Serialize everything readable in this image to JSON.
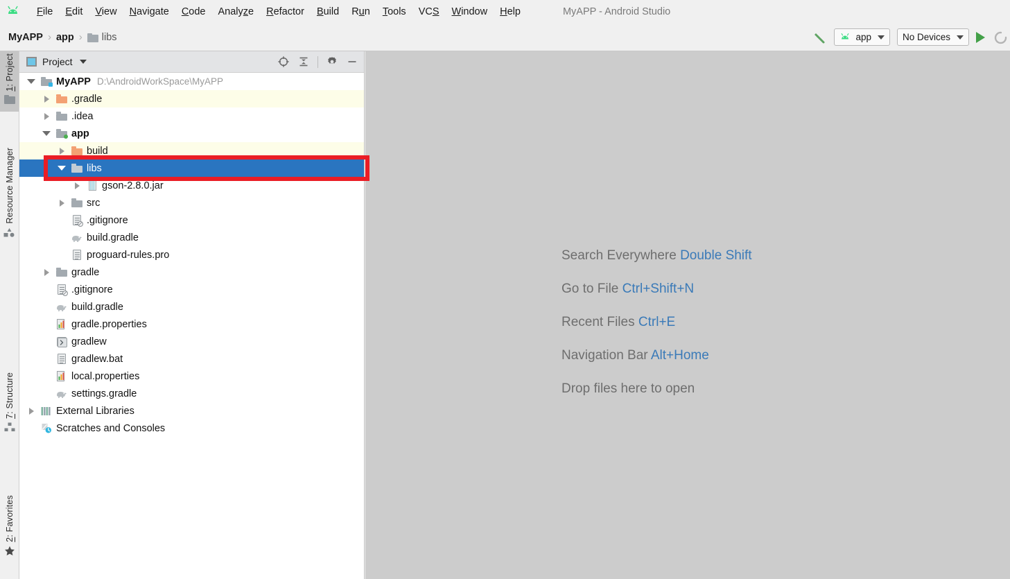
{
  "window": {
    "title": "MyAPP - Android Studio",
    "logo_icon": "android-robot-icon"
  },
  "menubar": {
    "items": [
      {
        "label": "File",
        "mnemonic": "F"
      },
      {
        "label": "Edit",
        "mnemonic": "E"
      },
      {
        "label": "View",
        "mnemonic": "V"
      },
      {
        "label": "Navigate",
        "mnemonic": "N"
      },
      {
        "label": "Code",
        "mnemonic": "C"
      },
      {
        "label": "Analyze",
        "mnemonic": "z"
      },
      {
        "label": "Refactor",
        "mnemonic": "R"
      },
      {
        "label": "Build",
        "mnemonic": "B"
      },
      {
        "label": "Run",
        "mnemonic": "u"
      },
      {
        "label": "Tools",
        "mnemonic": "T"
      },
      {
        "label": "VCS",
        "mnemonic": "S"
      },
      {
        "label": "Window",
        "mnemonic": "W"
      },
      {
        "label": "Help",
        "mnemonic": "H"
      }
    ]
  },
  "toolbar": {
    "breadcrumb": [
      {
        "label": "MyAPP",
        "style": "strong"
      },
      {
        "label": "app",
        "style": "strong"
      },
      {
        "label": "libs",
        "style": "plain",
        "icon": "folder-icon"
      }
    ],
    "separator": "›",
    "build_icon": "hammer-icon",
    "run_config": "app",
    "run_config_icon": "android-robot-icon",
    "device_selector": "No Devices",
    "run_icon": "run-triangle-icon",
    "debug_icon": "debug-icon"
  },
  "stripe": {
    "left_top": [
      {
        "label": "1: Project",
        "mnemonic": "1",
        "icon": "project-folder-icon",
        "active": true
      },
      {
        "label": "Resource Manager",
        "icon": "shapes-icon",
        "active": false
      }
    ],
    "left_bottom": [
      {
        "label": "7: Structure",
        "mnemonic": "7",
        "icon": "structure-icon",
        "active": false
      },
      {
        "label": "2: Favorites",
        "mnemonic": "2",
        "icon": "star-icon",
        "active": false
      }
    ]
  },
  "project_panel": {
    "header": {
      "title": "Project",
      "view_icon": "project-view-icon",
      "caret_icon": "chevron-down-icon",
      "locate_icon": "locate-target-icon",
      "collapse_icon": "collapse-all-icon",
      "settings_icon": "gear-icon",
      "minimize_icon": "minimize-icon"
    },
    "tree": [
      {
        "id": "root-myapp",
        "label": "MyAPP",
        "path": "D:\\AndroidWorkSpace\\MyAPP",
        "indent": 0,
        "twisty": "down",
        "icon": "folder-module-icon",
        "icon_kind": "folder-gray-blue",
        "bold": true
      },
      {
        "id": "node-gradle-dir",
        "label": ".gradle",
        "indent": 1,
        "twisty": "right",
        "icon": "folder-excluded-icon",
        "icon_kind": "folder-orange",
        "excluded": true
      },
      {
        "id": "node-idea",
        "label": ".idea",
        "indent": 1,
        "twisty": "right",
        "icon": "folder-icon",
        "icon_kind": "folder-gray"
      },
      {
        "id": "node-app",
        "label": "app",
        "indent": 1,
        "twisty": "down",
        "icon": "folder-module-icon",
        "icon_kind": "folder-gray-green",
        "bold": true
      },
      {
        "id": "node-app-build",
        "label": "build",
        "indent": 2,
        "twisty": "right",
        "icon": "folder-excluded-icon",
        "icon_kind": "folder-orange",
        "excluded": true
      },
      {
        "id": "node-app-libs",
        "label": "libs",
        "indent": 2,
        "twisty": "down",
        "icon": "folder-icon",
        "icon_kind": "folder-gray",
        "selected": true
      },
      {
        "id": "node-gson-jar",
        "label": "gson-2.8.0.jar",
        "indent": 3,
        "twisty": "right",
        "icon": "jar-icon",
        "icon_kind": "jar"
      },
      {
        "id": "node-app-src",
        "label": "src",
        "indent": 2,
        "twisty": "right",
        "icon": "folder-icon",
        "icon_kind": "folder-gray"
      },
      {
        "id": "node-app-gitignore",
        "label": ".gitignore",
        "indent": 2,
        "twisty": "none",
        "icon": "gitignore-file-icon",
        "icon_kind": "doc-ignored"
      },
      {
        "id": "node-app-build-gradle",
        "label": "build.gradle",
        "indent": 2,
        "twisty": "none",
        "icon": "gradle-elephant-icon",
        "icon_kind": "gradle"
      },
      {
        "id": "node-proguard",
        "label": "proguard-rules.pro",
        "indent": 2,
        "twisty": "none",
        "icon": "text-file-icon",
        "icon_kind": "doc"
      },
      {
        "id": "node-gradle-wrapper",
        "label": "gradle",
        "indent": 1,
        "twisty": "right",
        "icon": "folder-icon",
        "icon_kind": "folder-gray"
      },
      {
        "id": "node-root-gitignore",
        "label": ".gitignore",
        "indent": 1,
        "twisty": "none",
        "icon": "gitignore-file-icon",
        "icon_kind": "doc-ignored"
      },
      {
        "id": "node-root-build-gradle",
        "label": "build.gradle",
        "indent": 1,
        "twisty": "none",
        "icon": "gradle-elephant-icon",
        "icon_kind": "gradle"
      },
      {
        "id": "node-gradle-properties",
        "label": "gradle.properties",
        "indent": 1,
        "twisty": "none",
        "icon": "properties-file-icon",
        "icon_kind": "props"
      },
      {
        "id": "node-gradlew",
        "label": "gradlew",
        "indent": 1,
        "twisty": "none",
        "icon": "shell-script-icon",
        "icon_kind": "script"
      },
      {
        "id": "node-gradlew-bat",
        "label": "gradlew.bat",
        "indent": 1,
        "twisty": "none",
        "icon": "text-file-icon",
        "icon_kind": "doc"
      },
      {
        "id": "node-local-properties",
        "label": "local.properties",
        "indent": 1,
        "twisty": "none",
        "icon": "properties-file-icon",
        "icon_kind": "props"
      },
      {
        "id": "node-settings-gradle",
        "label": "settings.gradle",
        "indent": 1,
        "twisty": "none",
        "icon": "gradle-elephant-icon",
        "icon_kind": "gradle"
      },
      {
        "id": "node-external-libraries",
        "label": "External Libraries",
        "indent": 0,
        "twisty": "right",
        "icon": "libraries-icon",
        "icon_kind": "extlib"
      },
      {
        "id": "node-scratches",
        "label": "Scratches and Consoles",
        "indent": 0,
        "twisty": "none",
        "icon": "scratches-icon",
        "icon_kind": "scratch"
      }
    ]
  },
  "annotation": {
    "shape": "rectangle",
    "color": "#ea1d25",
    "targets": "node-app-libs"
  },
  "editor": {
    "hints": [
      {
        "action": "Search Everywhere",
        "shortcut": "Double Shift"
      },
      {
        "action": "Go to File",
        "shortcut": "Ctrl+Shift+N"
      },
      {
        "action": "Recent Files",
        "shortcut": "Ctrl+E"
      },
      {
        "action": "Navigation Bar",
        "shortcut": "Alt+Home"
      },
      {
        "action": "Drop files here to open",
        "shortcut": ""
      }
    ]
  },
  "colors": {
    "selection_blue": "#2a75c0",
    "annotation_red": "#ea1d25",
    "excluded_yellow": "#fdfde8",
    "editor_bg": "#cccccc",
    "accent_green": "#43a048",
    "hint_key_blue": "#3a7ab8"
  }
}
